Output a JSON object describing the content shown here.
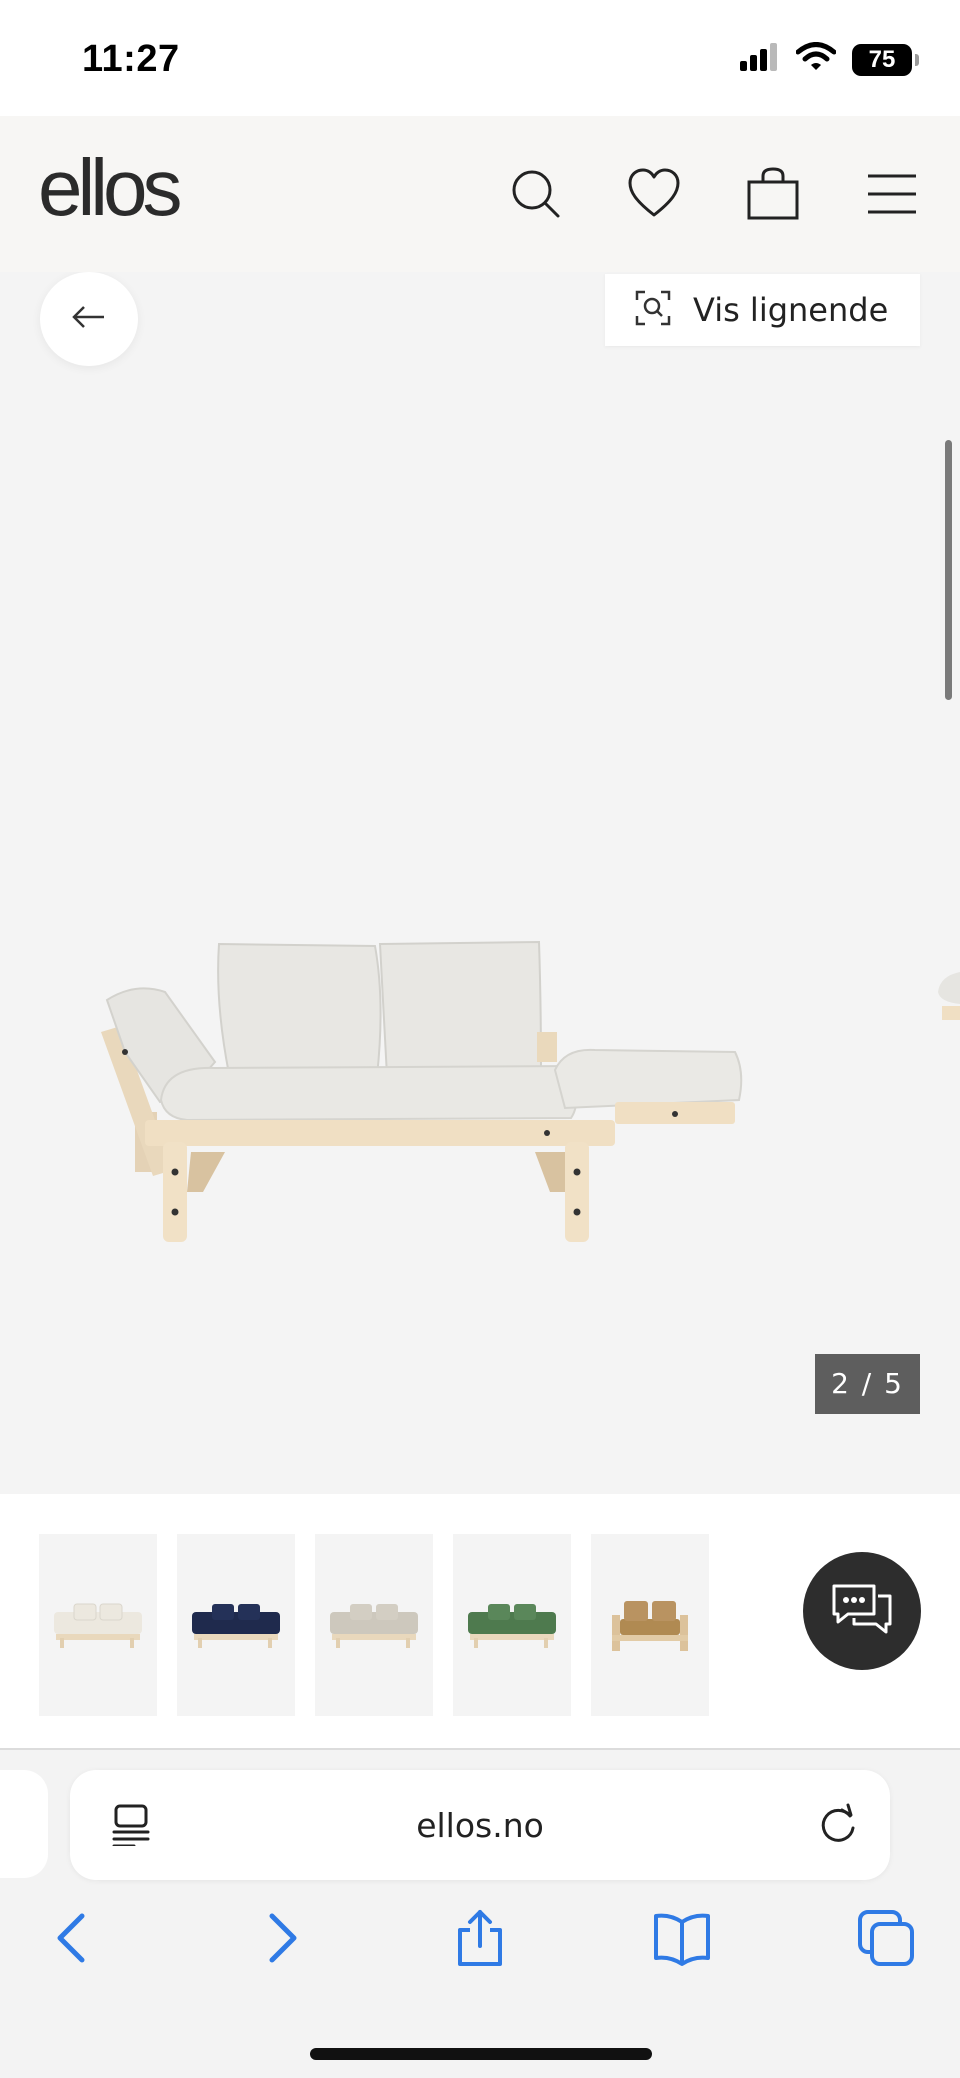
{
  "status_bar": {
    "time": "11:27",
    "battery": "75",
    "icons": [
      "cellular-signal-icon",
      "wifi-icon",
      "battery-icon"
    ]
  },
  "header": {
    "logo": "ellos",
    "icons": [
      "search-icon",
      "heart-icon",
      "shopping-bag-icon",
      "menu-icon"
    ]
  },
  "gallery": {
    "similar_label": "Vis lignende",
    "counter": "2 / 5",
    "icons": [
      "back-arrow-icon",
      "visual-search-icon"
    ]
  },
  "thumbnails": {
    "colors": [
      "#ece8df",
      "#1f2a4d",
      "#cdc8bd",
      "#4e7a4e",
      "#b08a52"
    ],
    "chat_icon": "chat-bubbles-icon"
  },
  "browser": {
    "url": "ellos.no",
    "icons": [
      "reader-icon",
      "reload-icon",
      "back-icon",
      "forward-icon",
      "share-icon",
      "bookmarks-icon",
      "tabs-icon"
    ],
    "accent": "#2f7ae5"
  }
}
